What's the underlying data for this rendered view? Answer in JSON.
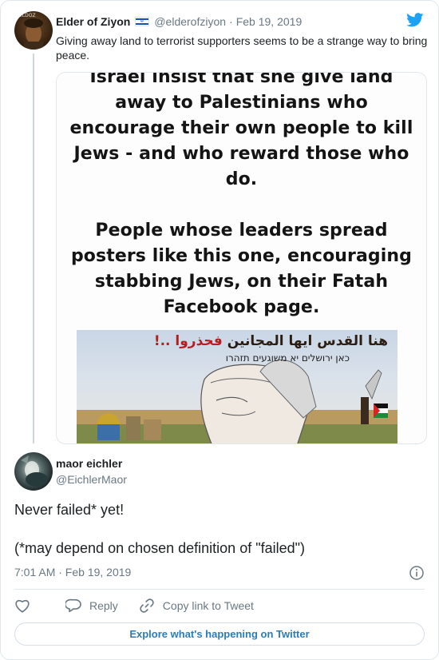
{
  "parent_tweet": {
    "author_name": "Elder of Ziyon",
    "avatar_label": "ELDOZ",
    "flag_icon": "israel-flag-icon",
    "handle": "@elderofziyon",
    "separator": "·",
    "date": "Feb 19, 2019",
    "text": "Giving away land to terrorist supporters seems to be a strange way to bring peace.",
    "media": {
      "lines_para1": [
        "Israel insist that she give land",
        "away to Palestinians who",
        "encourage their own people to kill",
        "Jews - and who reward those who",
        "do."
      ],
      "lines_para2": [
        "People whose leaders spread",
        "posters like this one, encouraging",
        "stabbing Jews, on their Fatah",
        "Facebook page."
      ],
      "poster_arabic_main": "هنا القدس ايها المجانين ",
      "poster_arabic_red": "فحذروا ..!",
      "poster_hebrew": "כאן ירושלים יא משוגעים תזהרו"
    }
  },
  "tweet": {
    "author_name": "maor eichler",
    "handle": "@EichlerMaor",
    "text": "Never failed* yet!\n\n(*may depend on chosen definition of \"failed\")",
    "timestamp": "7:01 AM · Feb 19, 2019"
  },
  "actions": {
    "reply_label": "Reply",
    "copy_link_label": "Copy link to Tweet"
  },
  "explore_label": "Explore what's happening on Twitter",
  "colors": {
    "twitter_blue": "#1da1f2",
    "link_blue": "#2b7bb9",
    "secondary_text": "#697882",
    "border": "#e1e8ed"
  },
  "icons": [
    "twitter-bird-icon",
    "heart-icon",
    "reply-icon",
    "link-icon",
    "info-icon"
  ]
}
